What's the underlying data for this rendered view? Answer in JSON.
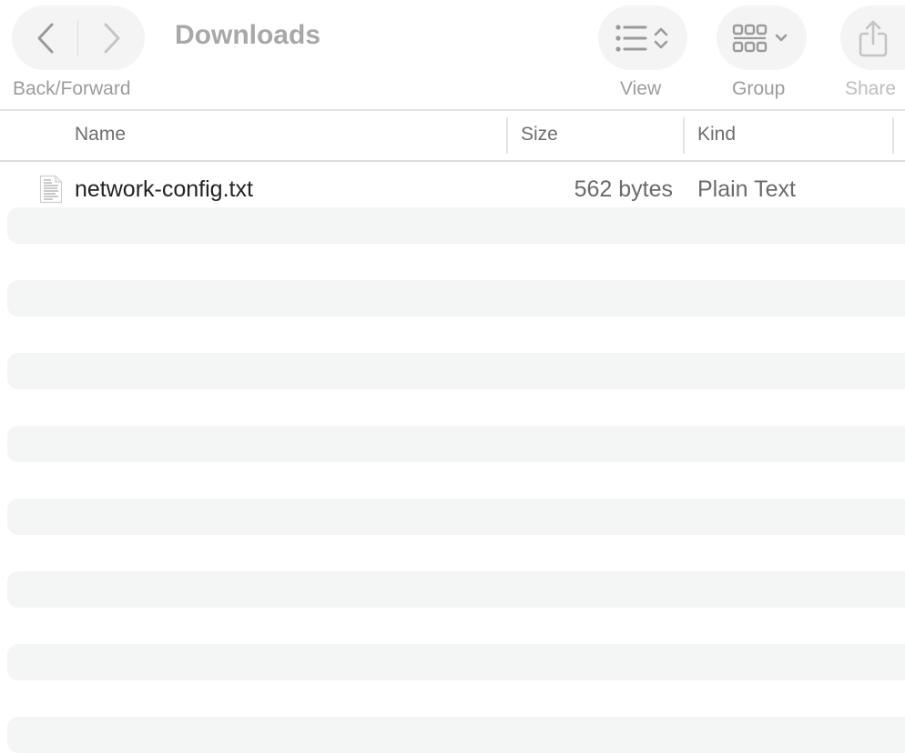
{
  "toolbar": {
    "title": "Downloads",
    "back_forward_label": "Back/Forward",
    "view_label": "View",
    "group_label": "Group",
    "share_label": "Share",
    "icons": {
      "back": "chevron-left-icon",
      "forward": "chevron-right-icon",
      "view": "list-view-icon",
      "group": "group-grid-icon",
      "share": "share-icon"
    }
  },
  "columns": {
    "name": "Name",
    "size": "Size",
    "kind": "Kind"
  },
  "files": [
    {
      "name": "network-config.txt",
      "size": "562 bytes",
      "kind": "Plain Text",
      "icon": "text-document-icon"
    }
  ],
  "colors": {
    "stripe": "#f4f5f5",
    "toolbar_pill": "#f4f4f4",
    "muted_text": "#9c9c9c"
  }
}
